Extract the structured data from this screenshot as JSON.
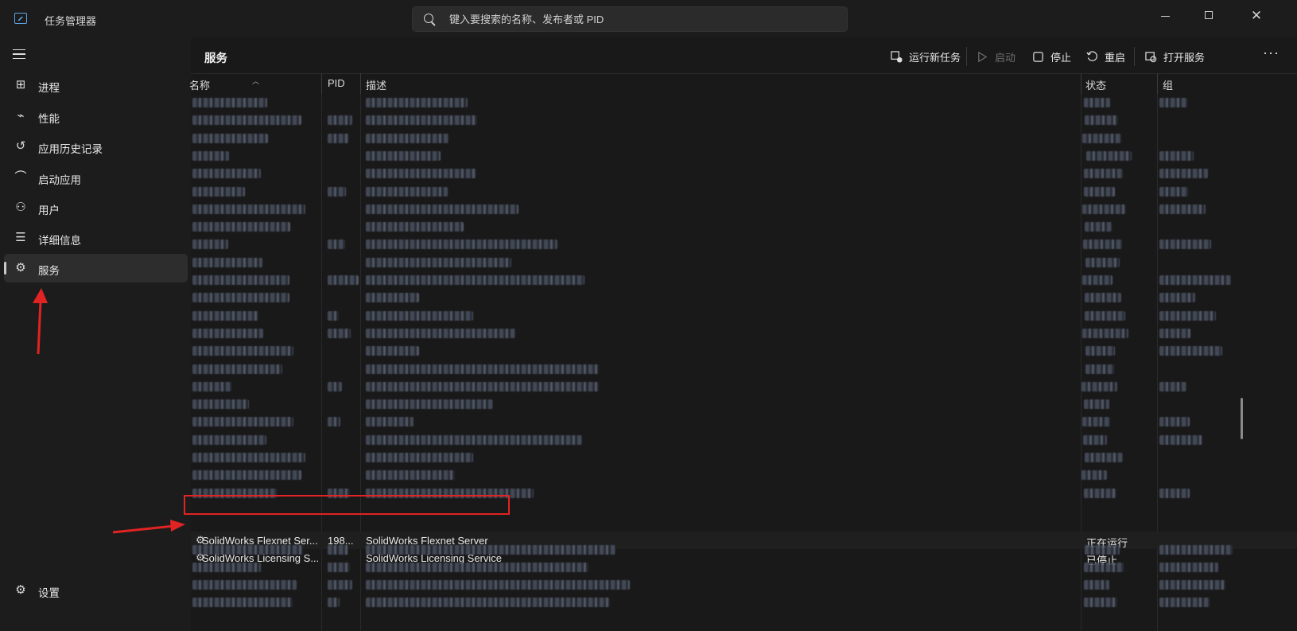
{
  "window": {
    "title": "任务管理器",
    "search_placeholder": "键入要搜索的名称、发布者或 PID"
  },
  "sidebar": {
    "items": [
      {
        "label": "进程",
        "icon": "processes-icon"
      },
      {
        "label": "性能",
        "icon": "performance-icon"
      },
      {
        "label": "应用历史记录",
        "icon": "app-history-icon"
      },
      {
        "label": "启动应用",
        "icon": "startup-apps-icon"
      },
      {
        "label": "用户",
        "icon": "users-icon"
      },
      {
        "label": "详细信息",
        "icon": "details-icon"
      },
      {
        "label": "服务",
        "icon": "services-icon",
        "active": true
      }
    ],
    "settings_label": "设置"
  },
  "main": {
    "page_title": "服务",
    "toolbar": {
      "run_new_task": "运行新任务",
      "start": "启动",
      "stop": "停止",
      "restart": "重启",
      "open_services": "打开服务"
    },
    "columns": {
      "name": "名称",
      "pid": "PID",
      "description": "描述",
      "status": "状态",
      "group": "组"
    },
    "visible_rows": [
      {
        "name": "SolidWorks Flexnet Ser...",
        "pid": "198...",
        "description": "SolidWorks Flexnet Server",
        "status": "正在运行",
        "highlighted": true
      },
      {
        "name": "SolidWorks Licensing S...",
        "pid": "",
        "description": "SolidWorks Licensing Service",
        "status": "已停止"
      }
    ]
  },
  "annotations": {
    "arrow_color": "#e02323",
    "box_color": "#e02323"
  }
}
